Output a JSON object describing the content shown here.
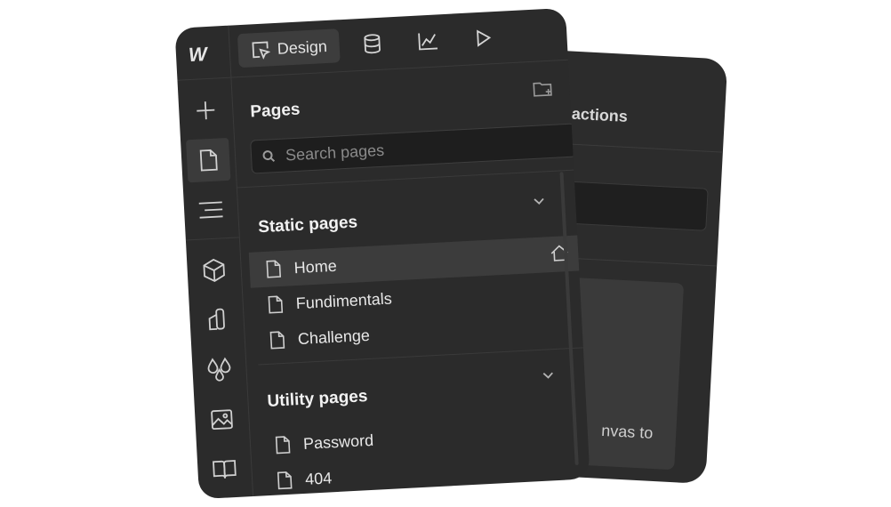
{
  "back_card": {
    "title_fragment": "actions",
    "text_fragment": "nvas to"
  },
  "toolbar": {
    "tabs": [
      {
        "label": "Design",
        "icon": "cursor-square-icon"
      },
      {
        "label": "",
        "icon": "database-icon"
      },
      {
        "label": "",
        "icon": "analytics-icon"
      },
      {
        "label": "",
        "icon": "play-icon"
      }
    ]
  },
  "rail": {
    "logo": "W",
    "items": [
      "add-icon",
      "page-icon",
      "navigator-icon",
      "components-icon",
      "style-manager-icon",
      "variables-icon",
      "assets-icon",
      "docs-icon"
    ],
    "active_index": 1
  },
  "pages_panel": {
    "title": "Pages",
    "search_placeholder": "Search pages",
    "sections": [
      {
        "title": "Static pages",
        "pages": [
          {
            "name": "Home",
            "active": true,
            "is_home": true
          },
          {
            "name": "Fundimentals",
            "active": false
          },
          {
            "name": "Challenge",
            "active": false
          }
        ]
      },
      {
        "title": "Utility pages",
        "pages": [
          {
            "name": "Password",
            "active": false
          },
          {
            "name": "404",
            "active": false
          }
        ]
      }
    ]
  },
  "colors": {
    "background": "#ffffff",
    "panel": "#2b2b2b",
    "active_row": "#3c3c3c",
    "text": "#e8e8e8"
  }
}
